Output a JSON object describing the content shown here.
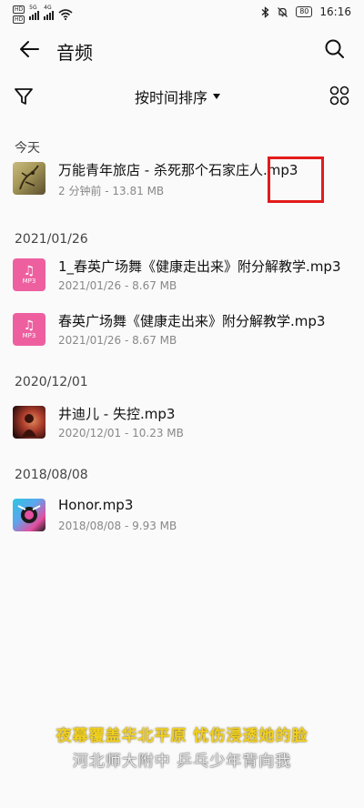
{
  "status": {
    "sim1": "HD",
    "sim2": "HD",
    "net1": "5G",
    "net2": "4G",
    "battery": "80",
    "time": "16:16"
  },
  "appbar": {
    "title": "音频"
  },
  "sort": {
    "label": "按时间排序"
  },
  "sections": [
    {
      "header": "今天",
      "files": [
        {
          "name": "万能青年旅店 - 杀死那个石家庄人.mp3",
          "meta": "2 分钟前 - 13.81 MB",
          "thumb": "album-art"
        }
      ]
    },
    {
      "header": "2021/01/26",
      "files": [
        {
          "name": "1_春英广场舞《健康走出来》附分解教学.mp3",
          "meta": "2021/01/26 - 8.67 MB",
          "thumb": "mp3-icon"
        },
        {
          "name": "春英广场舞《健康走出来》附分解教学.mp3",
          "meta": "2021/01/26 - 8.67 MB",
          "thumb": "mp3-icon"
        }
      ]
    },
    {
      "header": "2020/12/01",
      "files": [
        {
          "name": "井迪儿 - 失控.mp3",
          "meta": "2020/12/01 - 10.23 MB",
          "thumb": "album-art"
        }
      ]
    },
    {
      "header": "2018/08/08",
      "files": [
        {
          "name": "Honor.mp3",
          "meta": "2018/08/08 - 9.93 MB",
          "thumb": "album-art"
        }
      ]
    }
  ],
  "mp3_icon_label": "MP3",
  "subtitles": {
    "line1": "夜幕覆盖华北平原 忧伤浸透她的脸",
    "line2": "河北师大附中 乒乓少年背向我"
  },
  "colors": {
    "highlight": "#e21b1b",
    "mp3_icon": "#ee5fa0",
    "subtitle1": "#f0d020"
  }
}
